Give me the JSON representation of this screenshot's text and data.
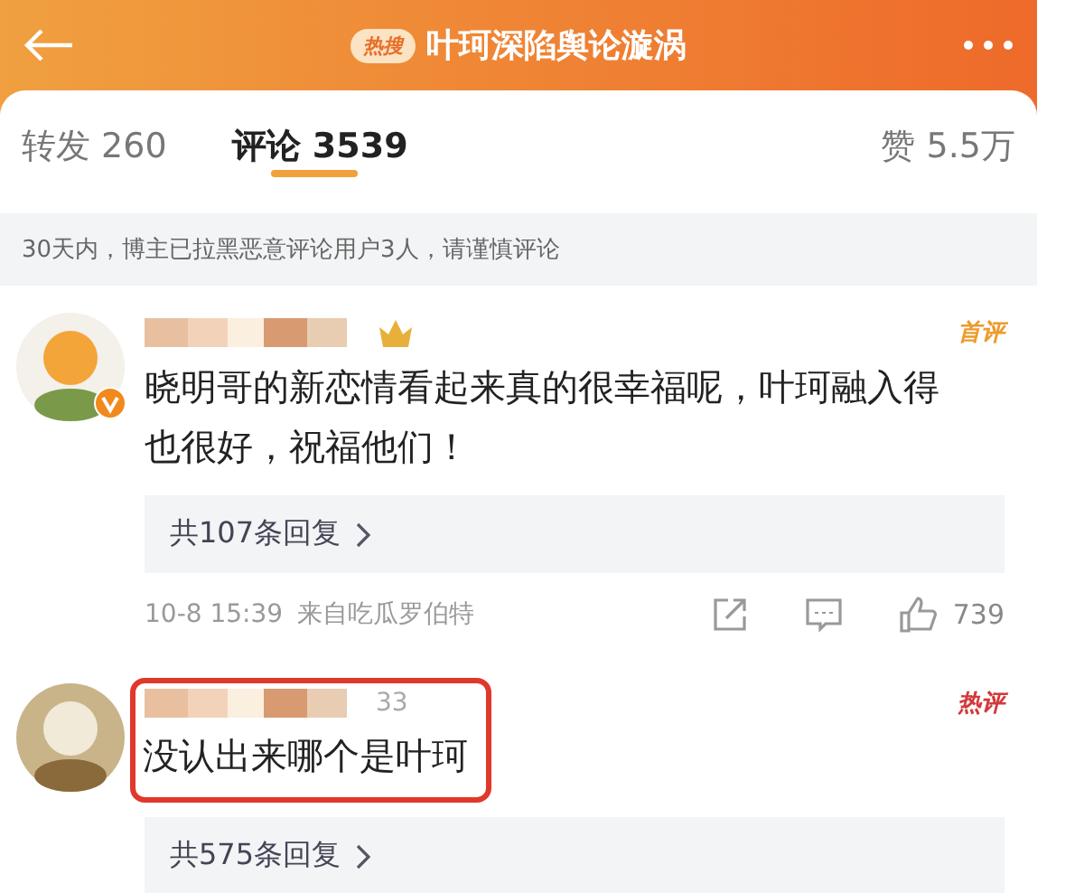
{
  "header": {
    "badge": "热搜",
    "title": "叶珂深陷舆论漩涡"
  },
  "tabs": [
    {
      "label": "转发 260",
      "selected": false
    },
    {
      "label": "评论 3539",
      "selected": true
    },
    {
      "label": "赞 5.5万",
      "selected": false
    }
  ],
  "notice": "30天内，博主已拉黑恶意评论用户3人，请谨慎评论",
  "comments": [
    {
      "kind": "first",
      "tag": "首评",
      "verified": true,
      "crown": true,
      "text": "晓明哥的新恋情看起来真的很幸福呢，叶珂融入得也很好，祝福他们！",
      "highlighted": false,
      "replies": "共107条回复",
      "time": "10-8 15:39",
      "source": "来自吃瓜罗伯特",
      "likes": "739"
    },
    {
      "kind": "hot",
      "tag": "热评",
      "verified": false,
      "crown": false,
      "name_suffix": "33",
      "text": "没认出来哪个是叶珂",
      "highlighted": true,
      "replies": "共575条回复"
    }
  ]
}
